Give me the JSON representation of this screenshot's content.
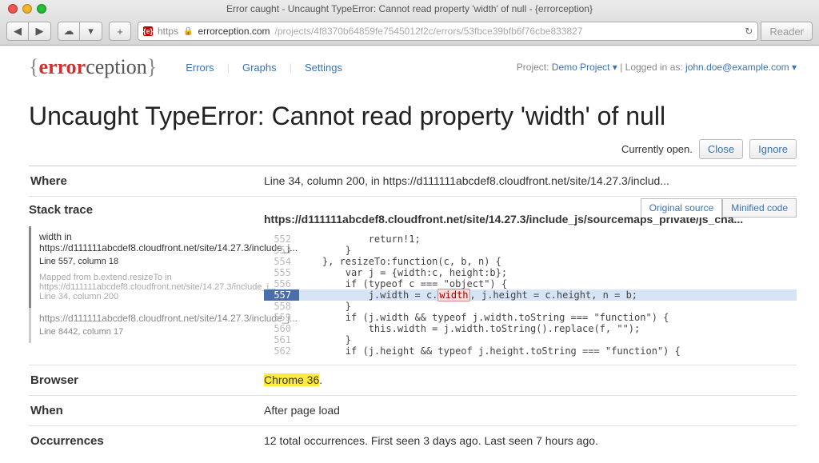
{
  "chrome": {
    "title": "Error caught - Uncaught TypeError: Cannot read property 'width' of null - {errorception}",
    "back": "◀",
    "fwd": "▶",
    "cloud": "☁",
    "share": "▾",
    "add": "+",
    "url_scheme": "https",
    "lock": "🔒",
    "url_host": "errorception.com",
    "url_path": "/projects/4f8370b64859fe7545012f2c/errors/53fbce39bfb6f76cbe833827",
    "reload": "↻",
    "reader": "Reader"
  },
  "brand": {
    "brace_l": "{",
    "p1": "error",
    "p2": "ception",
    "brace_r": "}"
  },
  "nav": {
    "errors": "Errors",
    "graphs": "Graphs",
    "settings": "Settings"
  },
  "user": {
    "project_label": "Project: ",
    "project_name": "Demo Project ▾",
    "sep": " | ",
    "login_label": "Logged in as: ",
    "login_user": "john.doe@example.com ▾"
  },
  "error_title": "Uncaught TypeError: Cannot read property 'width' of null",
  "status": {
    "text": "Currently open.",
    "close": "Close",
    "ignore": "Ignore"
  },
  "rows": {
    "where_label": "Where",
    "where_value": "Line 34, column 200, in https://d111111abcdef8.cloudfront.net/site/14.27.3/includ...",
    "stack_label": "Stack trace",
    "browser_label": "Browser",
    "browser_value": "Chrome 36",
    "browser_period": ".",
    "when_label": "When",
    "when_value": "After page load",
    "occ_label": "Occurrences",
    "occ_value": "12 total occurrences. First seen 3 days ago. Last seen 7 hours ago."
  },
  "frames": {
    "f1_title": "width in https://d111111abcdef8.cloudfront.net/site/14.27.3/include_j...",
    "f1_loc": "Line 557, column 18",
    "f1_mapped": "Mapped from b.extend.resizeTo in https://d111111abcdef8.cloudfront.net/site/14.27.3/include_j...",
    "f1_maploc": "Line 34, column 200",
    "f2_title": "https://d111111abcdef8.cloudfront.net/site/14.27.3/include_j...",
    "f2_loc": "Line 8442, column 17"
  },
  "code": {
    "tab_orig": "Original source",
    "tab_min": "Minified code",
    "path": "https://d111111abcdef8.cloudfront.net/site/14.27.3/include_js/sourcemaps_private/js_cha...",
    "l552n": "552",
    "l552": "            return!1;",
    "l553n": "553",
    "l553": "        }",
    "l554n": "554",
    "l554": "    }, resizeTo:function(c, b, n) {",
    "l555n": "555",
    "l555": "        var j = {width:c, height:b};",
    "l556n": "556",
    "l556": "        if (typeof c === \"object\") {",
    "l557n": "557",
    "l557a": "            j.width = c.",
    "l557tok": "width",
    "l557b": ", j.height = c.height, n = b;",
    "l558n": "558",
    "l558": "        }",
    "l559n": "559",
    "l559": "        if (j.width && typeof j.width.toString === \"function\") {",
    "l560n": "560",
    "l560": "            this.width = j.width.toString().replace(f, \"\");",
    "l561n": "561",
    "l561": "        }",
    "l562n": "562",
    "l562": "        if (j.height && typeof j.height.toString === \"function\") {"
  }
}
